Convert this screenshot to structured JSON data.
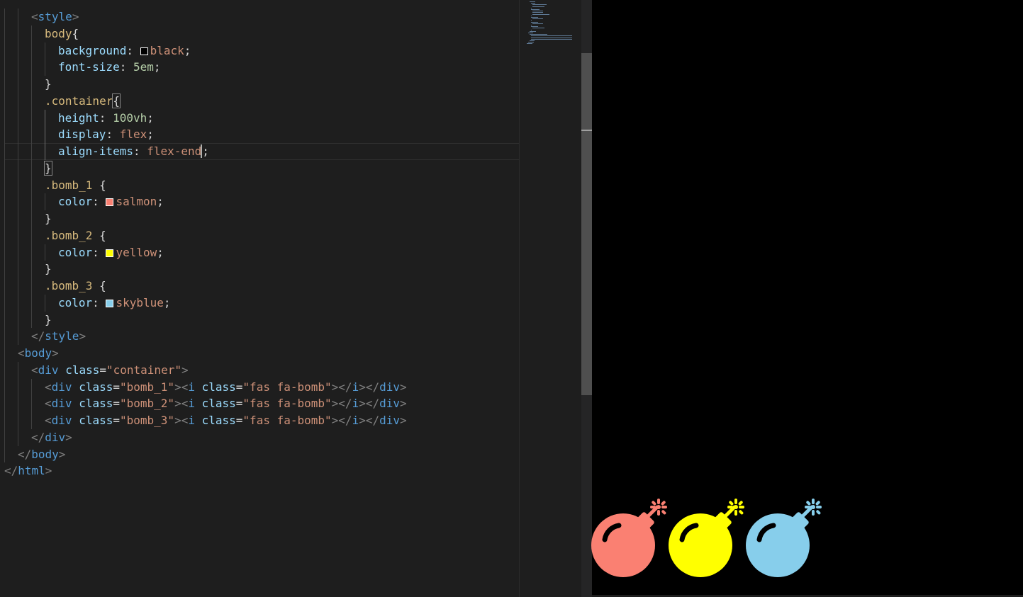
{
  "editor": {
    "lines": [
      {
        "indent": 2,
        "tokens": [
          [
            "tok-punc",
            "<"
          ],
          [
            "tok-tag",
            "style"
          ],
          [
            "tok-punc",
            ">"
          ]
        ]
      },
      {
        "indent": 3,
        "tokens": [
          [
            "tok-sel",
            "body"
          ],
          [
            "tok-brace",
            "{"
          ]
        ]
      },
      {
        "indent": 4,
        "tokens": [
          [
            "tok-prop",
            "background"
          ],
          [
            "tok-text",
            ": "
          ],
          [
            "swatch",
            "#000000"
          ],
          [
            "tok-val",
            "black"
          ],
          [
            "tok-text",
            ";"
          ]
        ]
      },
      {
        "indent": 4,
        "tokens": [
          [
            "tok-prop",
            "font-size"
          ],
          [
            "tok-text",
            ": "
          ],
          [
            "tok-num",
            "5em"
          ],
          [
            "tok-text",
            ";"
          ]
        ]
      },
      {
        "indent": 3,
        "tokens": [
          [
            "tok-brace",
            "}"
          ]
        ]
      },
      {
        "indent": 3,
        "tokens": [
          [
            "tok-sel",
            ".container"
          ],
          [
            "tok-brace match",
            "{"
          ]
        ]
      },
      {
        "indent": 4,
        "tokens": [
          [
            "tok-prop",
            "height"
          ],
          [
            "tok-text",
            ": "
          ],
          [
            "tok-num",
            "100vh"
          ],
          [
            "tok-text",
            ";"
          ]
        ]
      },
      {
        "indent": 4,
        "tokens": [
          [
            "tok-prop",
            "display"
          ],
          [
            "tok-text",
            ": "
          ],
          [
            "tok-val",
            "flex"
          ],
          [
            "tok-text",
            ";"
          ]
        ]
      },
      {
        "indent": 4,
        "current": true,
        "tokens": [
          [
            "tok-prop",
            "align-items"
          ],
          [
            "tok-text",
            ": "
          ],
          [
            "tok-val",
            "flex-end"
          ],
          [
            "cursor",
            ""
          ],
          [
            "tok-text",
            ";"
          ]
        ]
      },
      {
        "indent": 3,
        "tokens": [
          [
            "tok-brace match",
            "}"
          ]
        ]
      },
      {
        "indent": 3,
        "tokens": [
          [
            "tok-sel",
            ".bomb_1"
          ],
          [
            "tok-text",
            " {"
          ]
        ]
      },
      {
        "indent": 4,
        "tokens": [
          [
            "tok-prop",
            "color"
          ],
          [
            "tok-text",
            ": "
          ],
          [
            "swatch",
            "#fa8072"
          ],
          [
            "tok-val",
            "salmon"
          ],
          [
            "tok-text",
            ";"
          ]
        ]
      },
      {
        "indent": 3,
        "tokens": [
          [
            "tok-text",
            "}"
          ]
        ]
      },
      {
        "indent": 3,
        "tokens": [
          [
            "tok-sel",
            ".bomb_2"
          ],
          [
            "tok-text",
            " {"
          ]
        ]
      },
      {
        "indent": 4,
        "tokens": [
          [
            "tok-prop",
            "color"
          ],
          [
            "tok-text",
            ": "
          ],
          [
            "swatch",
            "#ffff00"
          ],
          [
            "tok-val",
            "yellow"
          ],
          [
            "tok-text",
            ";"
          ]
        ]
      },
      {
        "indent": 3,
        "tokens": [
          [
            "tok-text",
            "}"
          ]
        ]
      },
      {
        "indent": 3,
        "tokens": [
          [
            "tok-sel",
            ".bomb_3"
          ],
          [
            "tok-text",
            " {"
          ]
        ]
      },
      {
        "indent": 4,
        "tokens": [
          [
            "tok-prop",
            "color"
          ],
          [
            "tok-text",
            ": "
          ],
          [
            "swatch",
            "#87ceeb"
          ],
          [
            "tok-val",
            "skyblue"
          ],
          [
            "tok-text",
            ";"
          ]
        ]
      },
      {
        "indent": 3,
        "tokens": [
          [
            "tok-text",
            "}"
          ]
        ]
      },
      {
        "indent": 2,
        "tokens": [
          [
            "tok-punc",
            "</"
          ],
          [
            "tok-tag",
            "style"
          ],
          [
            "tok-punc",
            ">"
          ]
        ]
      },
      {
        "indent": 1,
        "tokens": [
          [
            "tok-punc",
            "<"
          ],
          [
            "tok-tag",
            "body"
          ],
          [
            "tok-punc",
            ">"
          ]
        ]
      },
      {
        "indent": 2,
        "tokens": [
          [
            "tok-punc",
            "<"
          ],
          [
            "tok-tag",
            "div"
          ],
          [
            "tok-text",
            " "
          ],
          [
            "tok-attr",
            "class"
          ],
          [
            "tok-text",
            "="
          ],
          [
            "tok-str",
            "\"container\""
          ],
          [
            "tok-punc",
            ">"
          ]
        ]
      },
      {
        "indent": 3,
        "tokens": [
          [
            "tok-punc",
            "<"
          ],
          [
            "tok-tag",
            "div"
          ],
          [
            "tok-text",
            " "
          ],
          [
            "tok-attr",
            "class"
          ],
          [
            "tok-text",
            "="
          ],
          [
            "tok-str",
            "\"bomb_1\""
          ],
          [
            "tok-punc",
            "><"
          ],
          [
            "tok-tag",
            "i"
          ],
          [
            "tok-text",
            " "
          ],
          [
            "tok-attr",
            "class"
          ],
          [
            "tok-text",
            "="
          ],
          [
            "tok-str",
            "\"fas fa-bomb\""
          ],
          [
            "tok-punc",
            "></"
          ],
          [
            "tok-tag",
            "i"
          ],
          [
            "tok-punc",
            "></"
          ],
          [
            "tok-tag",
            "div"
          ],
          [
            "tok-punc",
            ">"
          ]
        ]
      },
      {
        "indent": 3,
        "tokens": [
          [
            "tok-punc",
            "<"
          ],
          [
            "tok-tag",
            "div"
          ],
          [
            "tok-text",
            " "
          ],
          [
            "tok-attr",
            "class"
          ],
          [
            "tok-text",
            "="
          ],
          [
            "tok-str",
            "\"bomb_2\""
          ],
          [
            "tok-punc",
            "><"
          ],
          [
            "tok-tag",
            "i"
          ],
          [
            "tok-text",
            " "
          ],
          [
            "tok-attr",
            "class"
          ],
          [
            "tok-text",
            "="
          ],
          [
            "tok-str",
            "\"fas fa-bomb\""
          ],
          [
            "tok-punc",
            "></"
          ],
          [
            "tok-tag",
            "i"
          ],
          [
            "tok-punc",
            "></"
          ],
          [
            "tok-tag",
            "div"
          ],
          [
            "tok-punc",
            ">"
          ]
        ]
      },
      {
        "indent": 3,
        "tokens": [
          [
            "tok-punc",
            "<"
          ],
          [
            "tok-tag",
            "div"
          ],
          [
            "tok-text",
            " "
          ],
          [
            "tok-attr",
            "class"
          ],
          [
            "tok-text",
            "="
          ],
          [
            "tok-str",
            "\"bomb_3\""
          ],
          [
            "tok-punc",
            "><"
          ],
          [
            "tok-tag",
            "i"
          ],
          [
            "tok-text",
            " "
          ],
          [
            "tok-attr",
            "class"
          ],
          [
            "tok-text",
            "="
          ],
          [
            "tok-str",
            "\"fas fa-bomb\""
          ],
          [
            "tok-punc",
            "></"
          ],
          [
            "tok-tag",
            "i"
          ],
          [
            "tok-punc",
            "></"
          ],
          [
            "tok-tag",
            "div"
          ],
          [
            "tok-punc",
            ">"
          ]
        ]
      },
      {
        "indent": 2,
        "tokens": [
          [
            "tok-punc",
            "</"
          ],
          [
            "tok-tag",
            "div"
          ],
          [
            "tok-punc",
            ">"
          ]
        ]
      },
      {
        "indent": 1,
        "tokens": [
          [
            "tok-punc",
            "</"
          ],
          [
            "tok-tag",
            "body"
          ],
          [
            "tok-punc",
            ">"
          ]
        ]
      },
      {
        "indent": 0,
        "tokens": [
          [
            "tok-punc",
            "</"
          ],
          [
            "tok-tag",
            "html"
          ],
          [
            "tok-punc",
            ">"
          ]
        ]
      }
    ]
  },
  "preview": {
    "background": "#000000",
    "bombs": [
      {
        "name": "bomb-1-salmon-icon",
        "color": "#fa8072"
      },
      {
        "name": "bomb-2-yellow-icon",
        "color": "#ffff00"
      },
      {
        "name": "bomb-3-skyblue-icon",
        "color": "#87ceeb"
      }
    ]
  }
}
